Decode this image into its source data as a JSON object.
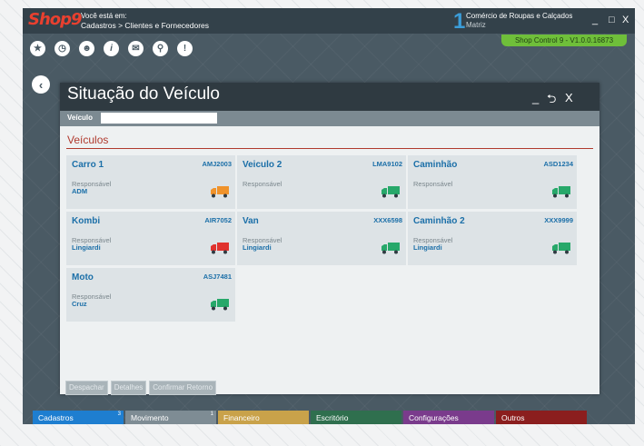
{
  "app": {
    "logo": "Shop9",
    "location_label": "Você está em:",
    "location_path": "Cadastros > Clientes e Fornecedores",
    "company_number": "1",
    "company_name": "Comércio de Roupas e Calçados",
    "company_sub": "Matriz",
    "version": "Shop Control 9 - V1.0.0.16873",
    "minimize": "_",
    "maximize": "□",
    "close": "X"
  },
  "toolbar_icons": [
    "star-icon",
    "clock-icon",
    "users-icon",
    "info-icon",
    "mail-icon",
    "search-icon",
    "alert-icon"
  ],
  "panel": {
    "title": "Situação do Veículo",
    "minimize": "_",
    "back": "⮌",
    "close": "X",
    "vehicle_label": "Veículo",
    "vehicle_value": "",
    "section": "Veículos",
    "responsavel_label": "Responsável"
  },
  "vehicles": [
    {
      "name": "Carro 1",
      "plate": "AMJ2003",
      "responsavel": "ADM",
      "status": "orange",
      "status_color": "#f0932b"
    },
    {
      "name": "Veiculo 2",
      "plate": "LMA9102",
      "responsavel": "",
      "status": "green",
      "status_color": "#27a86a"
    },
    {
      "name": "Caminhão",
      "plate": "ASD1234",
      "responsavel": "",
      "status": "green",
      "status_color": "#27a86a"
    },
    {
      "name": "Kombi",
      "plate": "AIR7052",
      "responsavel": "Lingiardi",
      "status": "red",
      "status_color": "#e0322e"
    },
    {
      "name": "Van",
      "plate": "XXX6598",
      "responsavel": "Lingiardi",
      "status": "green",
      "status_color": "#27a86a"
    },
    {
      "name": "Caminhão 2",
      "plate": "XXX9999",
      "responsavel": "Lingiardi",
      "status": "green",
      "status_color": "#27a86a"
    },
    {
      "name": "Moto",
      "plate": "ASJ7481",
      "responsavel": "Cruz",
      "status": "green",
      "status_color": "#27a86a"
    }
  ],
  "actions": {
    "dispatch": "Despachar",
    "details": "Detalhes",
    "confirm_return": "Confirmar Retorno"
  },
  "bottom_tabs": [
    {
      "label": "Cadastros",
      "badge": "3",
      "color": "#1e7ed0"
    },
    {
      "label": "Movimento",
      "badge": "1",
      "color": "#7e8c94"
    },
    {
      "label": "Financeiro",
      "badge": "",
      "color": "#c9a24a"
    },
    {
      "label": "Escritório",
      "badge": "",
      "color": "#2f6f4e"
    },
    {
      "label": "Configurações",
      "badge": "",
      "color": "#7a3b8c"
    },
    {
      "label": "Outros",
      "badge": "",
      "color": "#8b1e1e"
    }
  ]
}
